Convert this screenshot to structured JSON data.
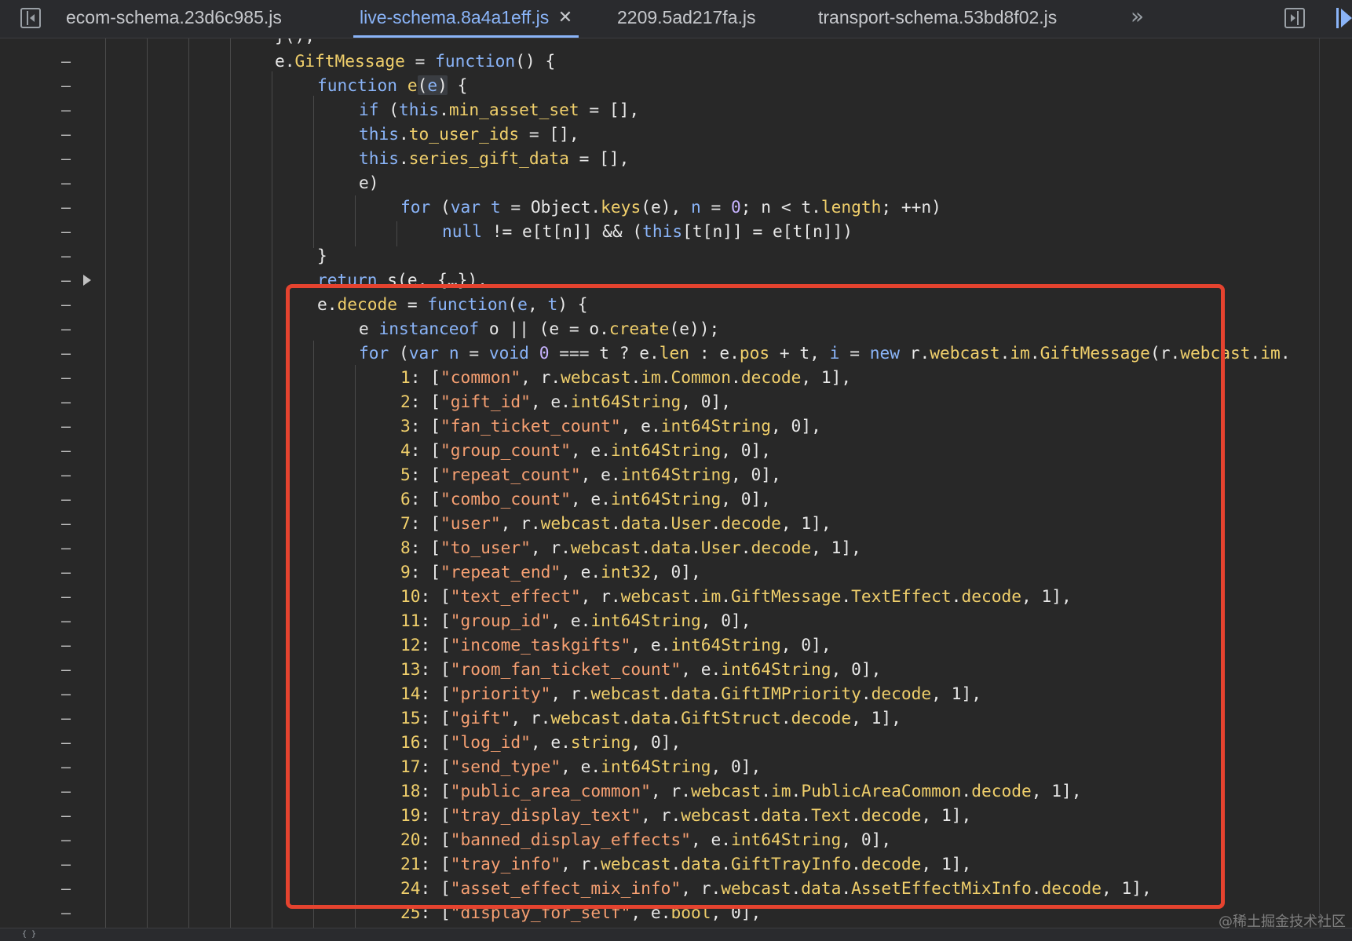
{
  "tabs": [
    {
      "label": "ecom-schema.23d6c985.js",
      "active": false
    },
    {
      "label": "live-schema.8a4a1eff.js",
      "active": true
    },
    {
      "label": "2209.5ad217fa.js",
      "active": false
    },
    {
      "label": "transport-schema.53bd8f02.js",
      "active": false
    }
  ],
  "tab_close_glyph": "✕",
  "more_tabs_glyph": "»",
  "icons": [
    "sidebar-toggle-icon",
    "close-icon",
    "more-tabs-icon",
    "right-panel-toggle-icon",
    "resume-debugger-icon",
    "fold-arrow-icon"
  ],
  "colors": {
    "background": "#282828",
    "keyword": "#8ab4f8",
    "property": "#f0cf6b",
    "string": "#f7a072",
    "number": "#c7b3ff",
    "annotation_box": "#e5432f",
    "active_tab": "#8ab4f8"
  },
  "code": {
    "gift_message_head": "e.GiftMessage = function() {",
    "ctor_head": "function e(e) {",
    "assign_min_asset": "if (this.min_asset_set = [],",
    "assign_to_user_ids": "this.to_user_ids = [],",
    "assign_series_gift": "this.series_gift_data = [],",
    "cond_e": "e)",
    "for_keys": "for (var t = Object.keys(e), n = 0; n < t.length; ++n)",
    "null_check": "null != e[t[n]] && (this[t[n]] = e[t[n]])",
    "close_brace": "}",
    "return_line": "return s(e, {…}),",
    "decode_head": "e.decode = function(e, t) {",
    "instanceof_line": "e instanceof o || (e = o.create(e));",
    "for_decode": "for (var n = void 0 === t ? e.len : e.pos + t, i = new r.webcast.im.GiftMessage(r.webcast.im.",
    "fields": [
      {
        "num": "1",
        "name": "\"common\"",
        "decoder": "r.webcast.im.Common.decode",
        "flag": "1"
      },
      {
        "num": "2",
        "name": "\"gift_id\"",
        "decoder": "e.int64String",
        "flag": "0"
      },
      {
        "num": "3",
        "name": "\"fan_ticket_count\"",
        "decoder": "e.int64String",
        "flag": "0"
      },
      {
        "num": "4",
        "name": "\"group_count\"",
        "decoder": "e.int64String",
        "flag": "0"
      },
      {
        "num": "5",
        "name": "\"repeat_count\"",
        "decoder": "e.int64String",
        "flag": "0"
      },
      {
        "num": "6",
        "name": "\"combo_count\"",
        "decoder": "e.int64String",
        "flag": "0"
      },
      {
        "num": "7",
        "name": "\"user\"",
        "decoder": "r.webcast.data.User.decode",
        "flag": "1"
      },
      {
        "num": "8",
        "name": "\"to_user\"",
        "decoder": "r.webcast.data.User.decode",
        "flag": "1"
      },
      {
        "num": "9",
        "name": "\"repeat_end\"",
        "decoder": "e.int32",
        "flag": "0"
      },
      {
        "num": "10",
        "name": "\"text_effect\"",
        "decoder": "r.webcast.im.GiftMessage.TextEffect.decode",
        "flag": "1"
      },
      {
        "num": "11",
        "name": "\"group_id\"",
        "decoder": "e.int64String",
        "flag": "0"
      },
      {
        "num": "12",
        "name": "\"income_taskgifts\"",
        "decoder": "e.int64String",
        "flag": "0"
      },
      {
        "num": "13",
        "name": "\"room_fan_ticket_count\"",
        "decoder": "e.int64String",
        "flag": "0"
      },
      {
        "num": "14",
        "name": "\"priority\"",
        "decoder": "r.webcast.data.GiftIMPriority.decode",
        "flag": "1"
      },
      {
        "num": "15",
        "name": "\"gift\"",
        "decoder": "r.webcast.data.GiftStruct.decode",
        "flag": "1"
      },
      {
        "num": "16",
        "name": "\"log_id\"",
        "decoder": "e.string",
        "flag": "0"
      },
      {
        "num": "17",
        "name": "\"send_type\"",
        "decoder": "e.int64String",
        "flag": "0"
      },
      {
        "num": "18",
        "name": "\"public_area_common\"",
        "decoder": "r.webcast.im.PublicAreaCommon.decode",
        "flag": "1"
      },
      {
        "num": "19",
        "name": "\"tray_display_text\"",
        "decoder": "r.webcast.data.Text.decode",
        "flag": "1"
      },
      {
        "num": "20",
        "name": "\"banned_display_effects\"",
        "decoder": "e.int64String",
        "flag": "0"
      },
      {
        "num": "21",
        "name": "\"tray_info\"",
        "decoder": "r.webcast.data.GiftTrayInfo.decode",
        "flag": "1"
      },
      {
        "num": "24",
        "name": "\"asset_effect_mix_info\"",
        "decoder": "r.webcast.data.AssetEffectMixInfo.decode",
        "flag": "1"
      },
      {
        "num": "25",
        "name": "\"display_for_self\"",
        "decoder": "e.bool",
        "flag": "0"
      }
    ]
  },
  "gutter_dash": "–",
  "watermark": "@稀土掘金技术社区"
}
